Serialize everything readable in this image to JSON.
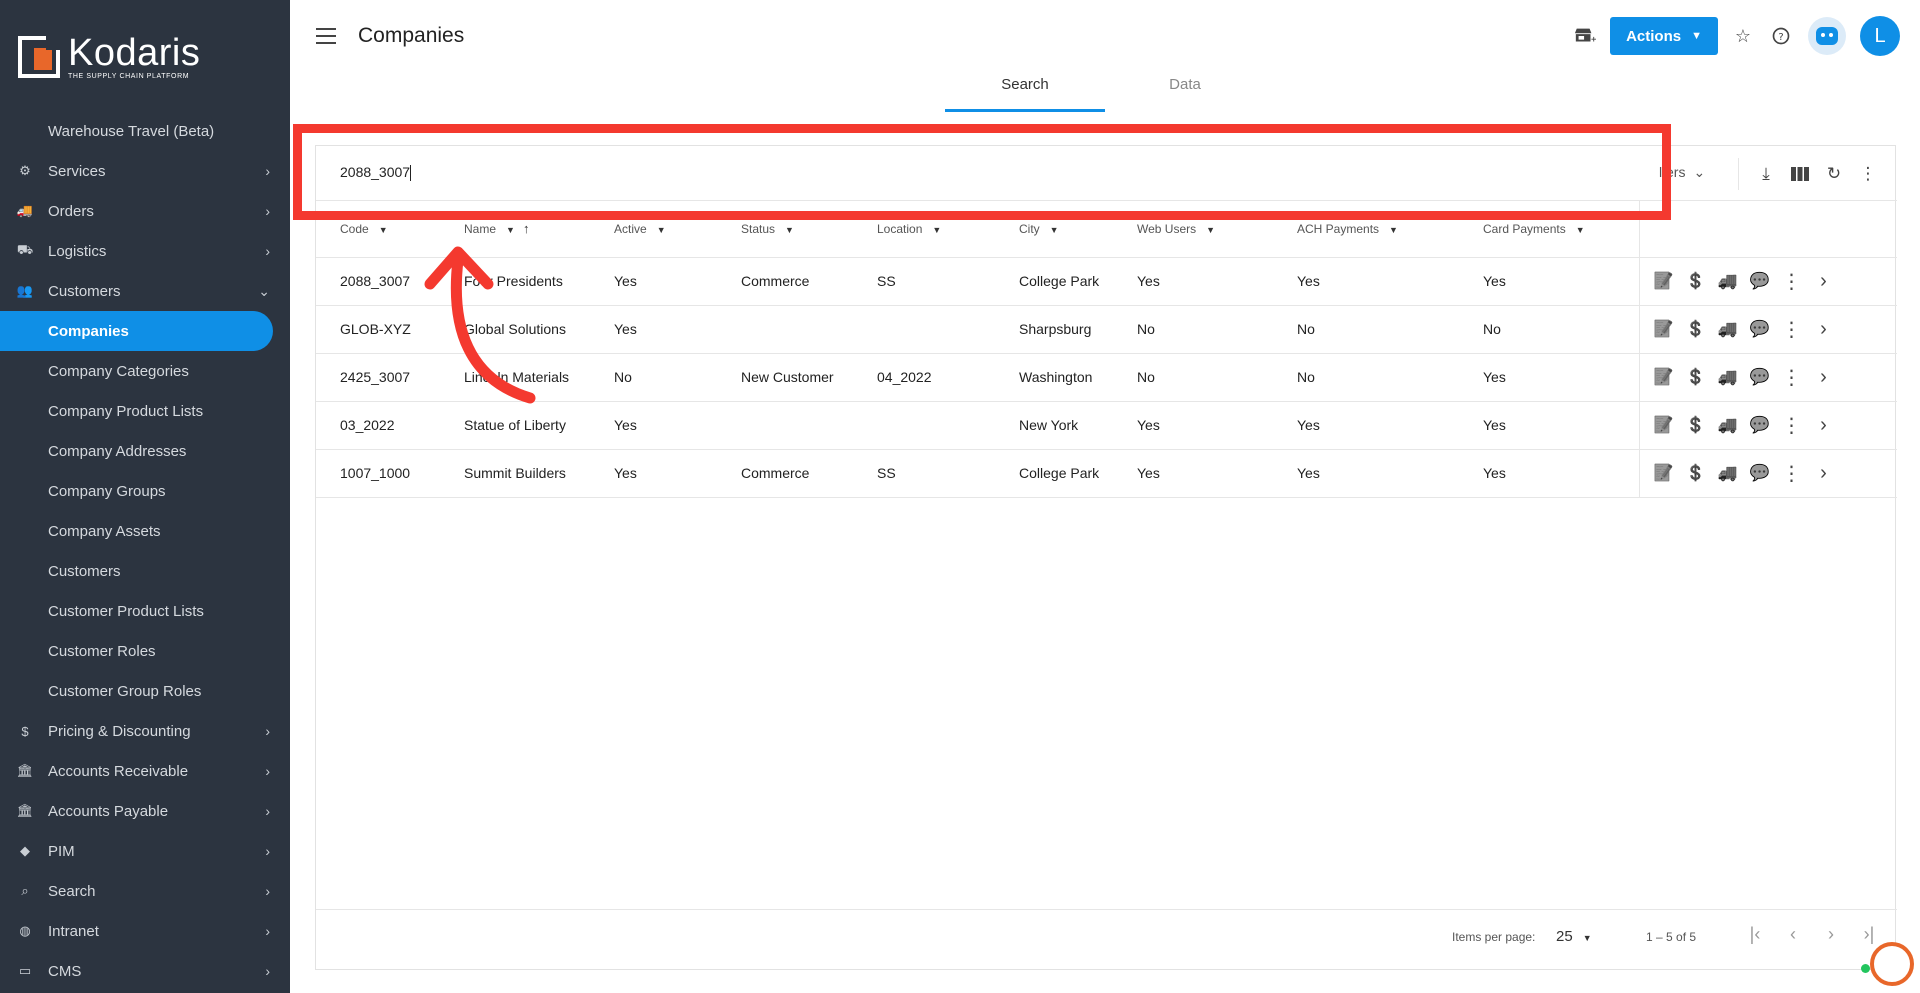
{
  "brand": {
    "name": "Kodaris",
    "tagline": "THE SUPPLY CHAIN PLATFORM",
    "accent": "#0f8fe6",
    "logo_color": "#e8672a"
  },
  "sidebar": {
    "items": [
      {
        "label": "Warehouse Travel (Beta)",
        "icon": "",
        "sub": true
      },
      {
        "label": "Services",
        "icon": "services-icon",
        "chevron": "›"
      },
      {
        "label": "Orders",
        "icon": "truck-icon",
        "chevron": "›"
      },
      {
        "label": "Logistics",
        "icon": "logistics-icon",
        "chevron": "›"
      },
      {
        "label": "Customers",
        "icon": "people-icon",
        "chevron": "⌄"
      },
      {
        "label": "Companies",
        "sub": true,
        "active": true
      },
      {
        "label": "Company Categories",
        "sub": true
      },
      {
        "label": "Company Product Lists",
        "sub": true
      },
      {
        "label": "Company Addresses",
        "sub": true
      },
      {
        "label": "Company Groups",
        "sub": true
      },
      {
        "label": "Company Assets",
        "sub": true
      },
      {
        "label": "Customers",
        "sub": true
      },
      {
        "label": "Customer Product Lists",
        "sub": true
      },
      {
        "label": "Customer Roles",
        "sub": true
      },
      {
        "label": "Customer Group Roles",
        "sub": true
      },
      {
        "label": "Pricing & Discounting",
        "icon": "dollar-icon",
        "chevron": "›"
      },
      {
        "label": "Accounts Receivable",
        "icon": "bank-icon",
        "chevron": "›"
      },
      {
        "label": "Accounts Payable",
        "icon": "bank-icon",
        "chevron": "›"
      },
      {
        "label": "PIM",
        "icon": "tag-icon",
        "chevron": "›"
      },
      {
        "label": "Search",
        "icon": "search-icon",
        "chevron": "›"
      },
      {
        "label": "Intranet",
        "icon": "globe-icon",
        "chevron": "›"
      },
      {
        "label": "CMS",
        "icon": "cms-icon",
        "chevron": "›"
      }
    ]
  },
  "header": {
    "title": "Companies",
    "actions_label": "Actions",
    "avatar_initial": "L",
    "tabs": [
      {
        "label": "Search",
        "active": true
      },
      {
        "label": "Data",
        "active": false
      }
    ]
  },
  "search": {
    "value": "2088_3007",
    "filters_label": "lters"
  },
  "table": {
    "columns": [
      "Code",
      "Name",
      "Active",
      "Status",
      "Location",
      "City",
      "Web Users",
      "ACH Payments",
      "Card Payments"
    ],
    "rows": [
      [
        "2088_3007",
        "Four Presidents",
        "Yes",
        "Commerce",
        "SS",
        "College Park",
        "Yes",
        "Yes",
        "Yes"
      ],
      [
        "GLOB-XYZ",
        "Global Solutions",
        "Yes",
        "",
        "",
        "Sharpsburg",
        "No",
        "No",
        "No"
      ],
      [
        "2425_3007",
        "Lincoln Materials",
        "No",
        "New Customer",
        "04_2022",
        "Washington",
        "No",
        "No",
        "Yes"
      ],
      [
        "03_2022",
        "Statue of Liberty",
        "Yes",
        "",
        "",
        "New York",
        "Yes",
        "Yes",
        "Yes"
      ],
      [
        "1007_1000",
        "Summit Builders",
        "Yes",
        "Commerce",
        "SS",
        "College Park",
        "Yes",
        "Yes",
        "Yes"
      ]
    ]
  },
  "paginator": {
    "items_per_page_label": "Items per page:",
    "page_size": "25",
    "range": "1 – 5 of 5"
  },
  "annotation": {
    "color": "#f4392f"
  }
}
